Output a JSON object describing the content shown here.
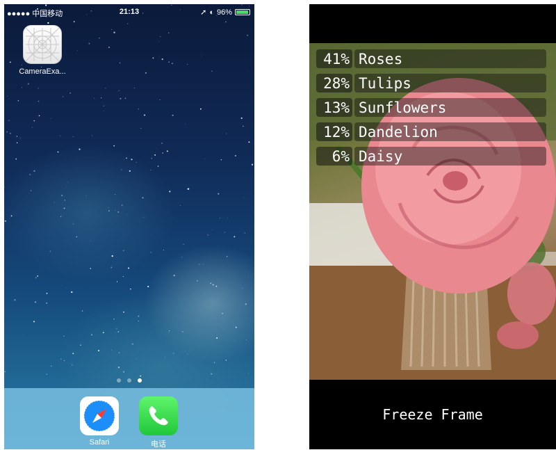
{
  "home_screen": {
    "status_bar": {
      "carrier": "●●●●● 中国移动",
      "time": "21:13",
      "battery": "96%",
      "battery_level": 0.96
    },
    "apps": [
      {
        "label": "CameraExa...",
        "icon": "camera-example-app-icon"
      }
    ],
    "page_dots": {
      "count": 3,
      "active_index": 2
    },
    "dock": [
      {
        "label": "Safari",
        "icon": "safari-compass-icon"
      },
      {
        "label": "电话",
        "icon": "phone-handset-icon"
      }
    ],
    "colors": {
      "dock": "#78bee1",
      "wallpaper_top": "#0b1a3a",
      "wallpaper_bottom": "#2a7fa8"
    }
  },
  "camera_app": {
    "predictions": [
      {
        "percent": "41%",
        "label": "Roses"
      },
      {
        "percent": "28%",
        "label": "Tulips"
      },
      {
        "percent": "13%",
        "label": "Sunflowers"
      },
      {
        "percent": "12%",
        "label": "Dandelion"
      },
      {
        "percent": "6%",
        "label": "Daisy"
      }
    ],
    "freeze_button": "Freeze Frame"
  }
}
